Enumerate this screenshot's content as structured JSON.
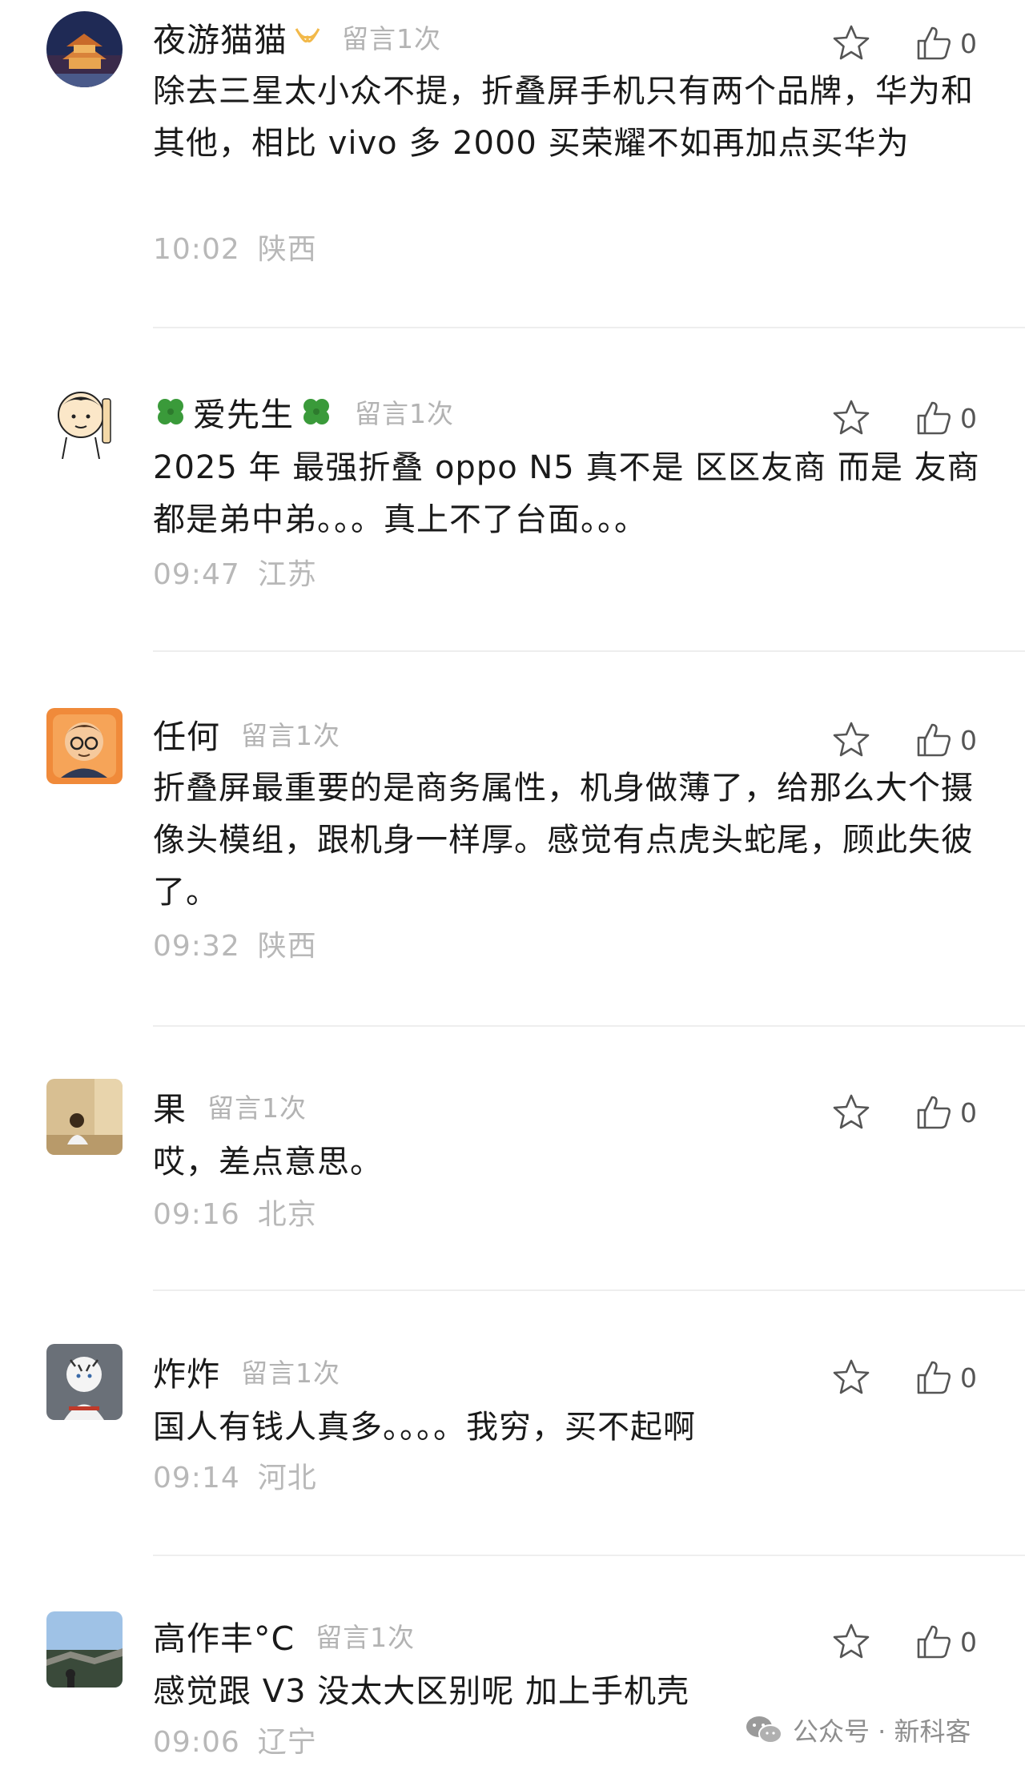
{
  "comments": [
    {
      "nickname": "夜游猫猫",
      "badge": "留言1次",
      "content": "除去三星太小众不提，折叠屏手机只有两个品牌，华为和其他，相比 vivo 多 2000 买荣耀不如再加点买华为",
      "time": "10:02",
      "location": "陕西",
      "likes": "0",
      "avatar_icon": "city-gate-avatar-icon"
    },
    {
      "nickname": "爱先生",
      "badge": "留言1次",
      "content": "2025 年 最强折叠 oppo N5 真不是 区区友商 而是 友商都是弟中弟。。。真上不了台面。。。",
      "time": "09:47",
      "location": "江苏",
      "likes": "0",
      "avatar_icon": "cartoon-man-avatar-icon"
    },
    {
      "nickname": "任何",
      "badge": "留言1次",
      "content": "折叠屏最重要的是商务属性，机身做薄了，给那么大个摄像头模组，跟机身一样厚。感觉有点虎头蛇尾，顾此失彼了。",
      "time": "09:32",
      "location": "陕西",
      "likes": "0",
      "avatar_icon": "glasses-man-avatar-icon"
    },
    {
      "nickname": "果",
      "badge": "留言1次",
      "content": "哎，差点意思。",
      "time": "09:16",
      "location": "北京",
      "likes": "0",
      "avatar_icon": "person-in-room-avatar-icon"
    },
    {
      "nickname": "炸炸",
      "badge": "留言1次",
      "content": "国人有钱人真多。。。。我穷，买不起啊",
      "time": "09:14",
      "location": "河北",
      "likes": "0",
      "avatar_icon": "white-tiger-avatar-icon"
    },
    {
      "nickname": "高作丰°C",
      "badge": "留言1次",
      "content": "感觉跟 V3 没太大区别呢 加上手机壳",
      "time": "09:06",
      "location": "辽宁",
      "likes": "0",
      "avatar_icon": "great-wall-avatar-icon"
    }
  ],
  "watermark": {
    "text": "公众号 · 新科客",
    "icon": "wechat-icon"
  },
  "colors": {
    "text_primary": "#1a1a1a",
    "text_meta": "#b8b8b8",
    "badge": "#b3b3b3",
    "divider": "#eeeeee",
    "accent_gold": "#f2b94a",
    "clover_green": "#3a9a3a"
  }
}
